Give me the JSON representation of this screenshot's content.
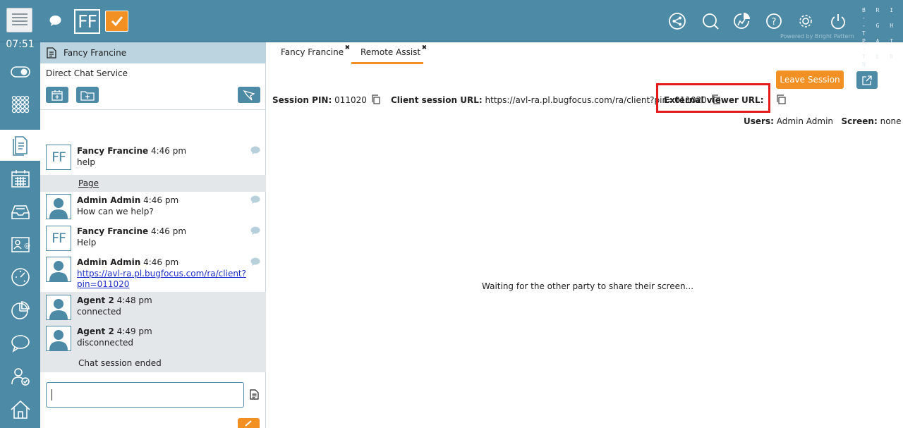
{
  "topbar": {
    "agent_initials": "FF",
    "brand_lines": [
      "B R I -",
      "- G H T",
      "P A T -",
      "T E R N"
    ],
    "powered_by": "Powered by Bright Pattern",
    "icons": [
      "share-icon",
      "search-icon",
      "reports-icon",
      "help-icon",
      "settings-icon",
      "power-icon"
    ]
  },
  "leftnav": {
    "clock": "07:51",
    "items": [
      "toggle-icon",
      "dialpad-icon",
      "documents-icon",
      "calendar-icon",
      "inbox-icon",
      "contacts-icon",
      "dashboard-icon",
      "pie-chart-icon",
      "chat-icon",
      "agent-status-icon",
      "home-icon"
    ]
  },
  "chat": {
    "header_title": "Fancy Francine",
    "service": "Direct Chat Service",
    "messages": [
      {
        "name": "Fancy Francine",
        "time": "4:46 pm",
        "text": "help",
        "avatar": "FF"
      },
      {
        "note": "Page"
      },
      {
        "name": "Admin Admin",
        "time": "4:46 pm",
        "text": "How can we help?",
        "avatar": "person"
      },
      {
        "name": "Fancy Francine",
        "time": "4:46 pm",
        "text": "Help",
        "avatar": "FF"
      },
      {
        "name": "Admin Admin",
        "time": "4:46 pm",
        "link_line1": "https://avl-ra.pl.bugfocus.com/ra/client?",
        "link_line2": "pin=011020",
        "avatar": "person"
      },
      {
        "name": "Agent 2",
        "time": "4:48 pm",
        "text": "connected",
        "avatar": "person"
      },
      {
        "name": "Agent 2",
        "time": "4:49 pm",
        "text": "disconnected",
        "avatar": "person"
      },
      {
        "note": "Chat session ended"
      }
    ],
    "input_value": ""
  },
  "main": {
    "tabs": [
      {
        "label": "Fancy Francine",
        "close": "✖"
      },
      {
        "label": "Remote Assist",
        "close": "✖"
      }
    ],
    "leave_label": "Leave Session",
    "session_pin_label": "Session PIN:",
    "session_pin": "011020",
    "client_url_label": "Client session URL:",
    "client_url": "https://avl-ra.pl.bugfocus.com/ra/client?pin=011020",
    "external_url_label": "External viewer URL:",
    "users_label": "Users:",
    "users_value": "Admin Admin",
    "screen_label": "Screen:",
    "screen_value": "none",
    "waiting": "Waiting for the other party to share their screen..."
  },
  "colors": {
    "accent": "#4d8aa6",
    "orange": "#f39024",
    "highlight": "#e41b1b"
  }
}
